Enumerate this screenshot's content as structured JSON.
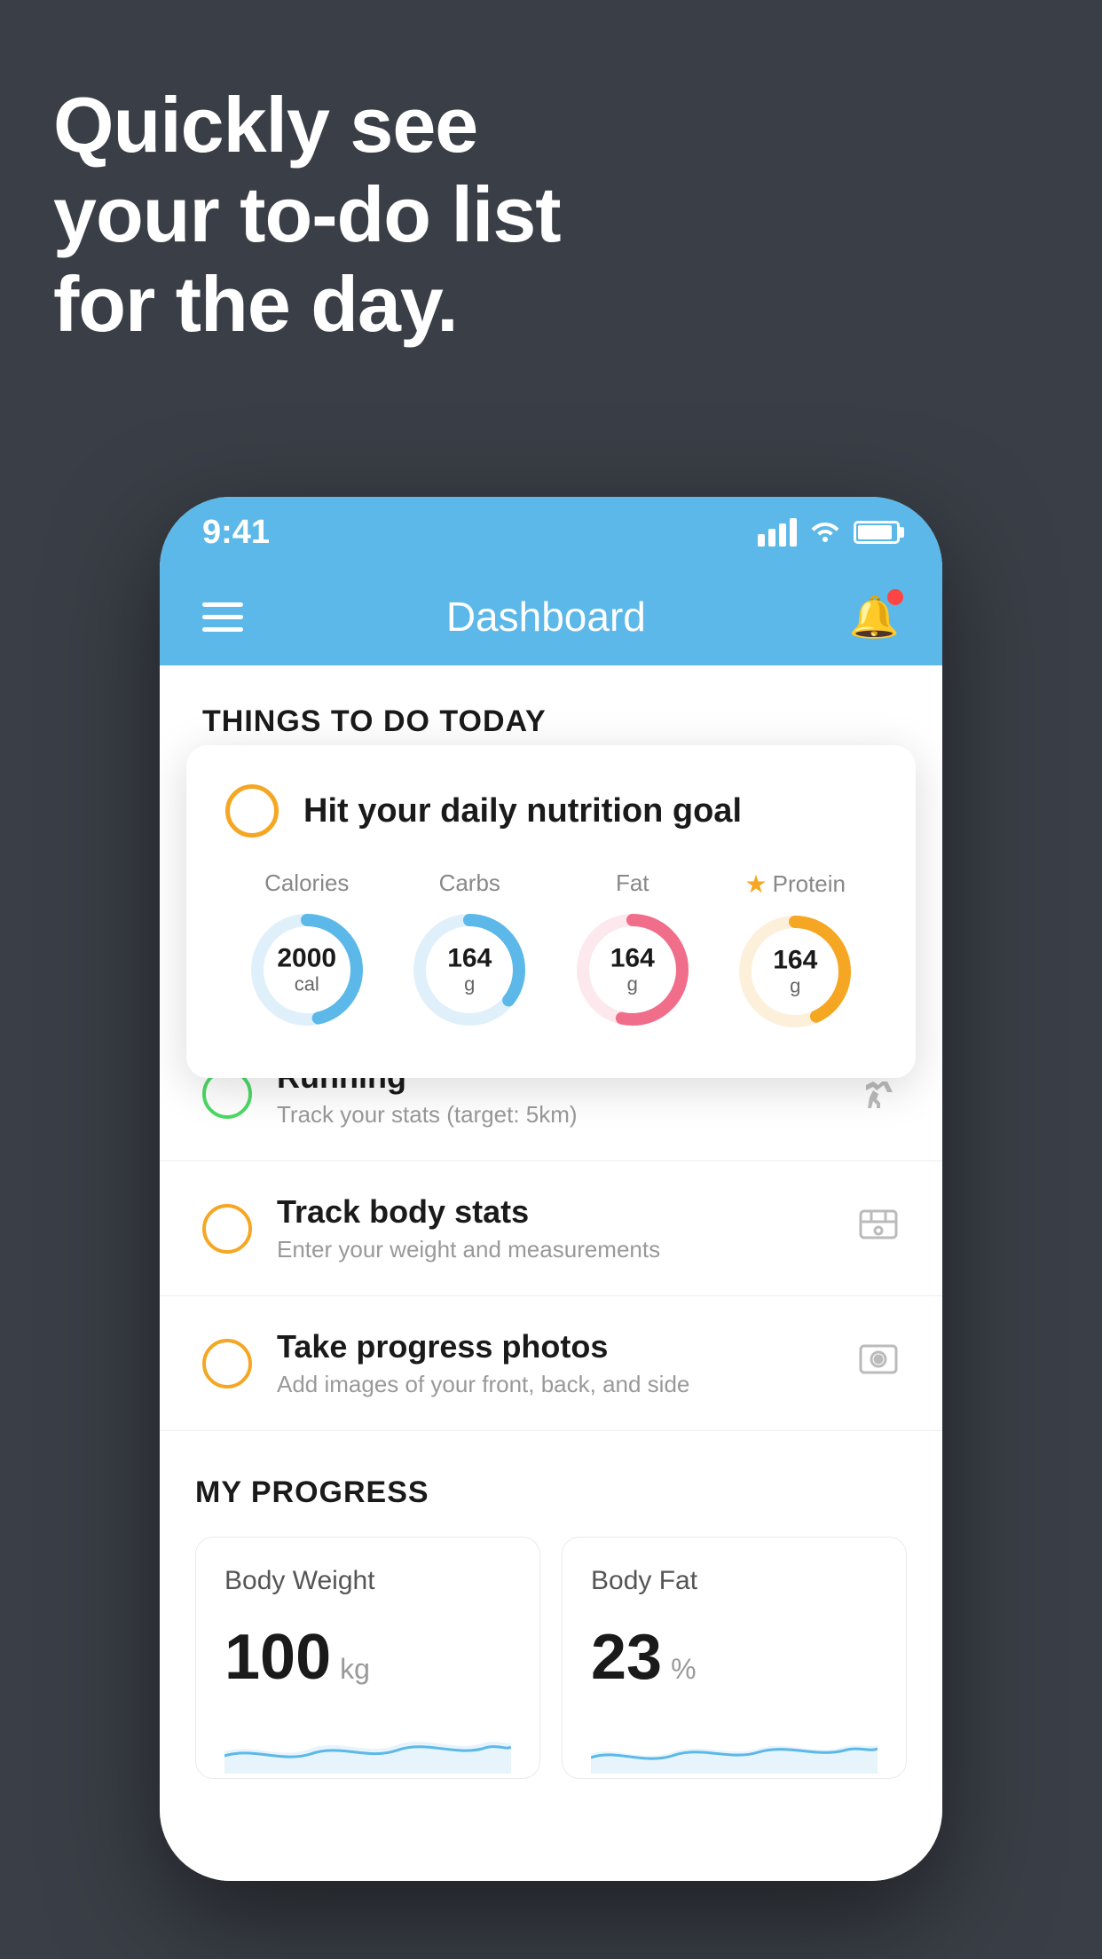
{
  "hero": {
    "line1": "Quickly see",
    "line2": "your to-do list",
    "line3": "for the day."
  },
  "status_bar": {
    "time": "9:41"
  },
  "nav": {
    "title": "Dashboard"
  },
  "things_section": {
    "heading": "THINGS TO DO TODAY"
  },
  "floating_card": {
    "title": "Hit your daily nutrition goal",
    "nutrition": [
      {
        "label": "Calories",
        "value": "2000",
        "unit": "cal",
        "color": "#5bb8e8",
        "track_color": "#e0f0fb",
        "percent": 65
      },
      {
        "label": "Carbs",
        "value": "164",
        "unit": "g",
        "color": "#5bb8e8",
        "track_color": "#e0f0fb",
        "percent": 50
      },
      {
        "label": "Fat",
        "value": "164",
        "unit": "g",
        "color": "#f06e8a",
        "track_color": "#fce8ed",
        "percent": 75
      },
      {
        "label": "Protein",
        "value": "164",
        "unit": "g",
        "color": "#f5a623",
        "track_color": "#fdf0db",
        "percent": 60,
        "starred": true
      }
    ]
  },
  "todo_items": [
    {
      "title": "Running",
      "subtitle": "Track your stats (target: 5km)",
      "circle_color": "green",
      "icon": "👟"
    },
    {
      "title": "Track body stats",
      "subtitle": "Enter your weight and measurements",
      "circle_color": "yellow",
      "icon": "⚖"
    },
    {
      "title": "Take progress photos",
      "subtitle": "Add images of your front, back, and side",
      "circle_color": "yellow",
      "icon": "👤"
    }
  ],
  "progress_section": {
    "heading": "MY PROGRESS",
    "cards": [
      {
        "title": "Body Weight",
        "value": "100",
        "unit": "kg"
      },
      {
        "title": "Body Fat",
        "value": "23",
        "unit": "%"
      }
    ]
  }
}
